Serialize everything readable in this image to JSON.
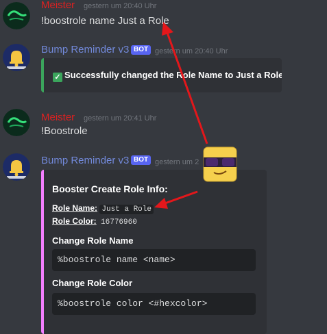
{
  "messages": [
    {
      "author": "Meister",
      "timestamp": "gestern um 20:40 Uhr",
      "content": "!boostrole name Just a Role"
    },
    {
      "author": "Bump Reminder v3",
      "badge": "BOT",
      "timestamp": "gestern um 20:40 Uhr",
      "embed_text": "Successfully changed the Role Name to Just a Role"
    },
    {
      "author": "Meister",
      "timestamp": "gestern um 20:41 Uhr",
      "content": "!Boostrole"
    },
    {
      "author": "Bump Reminder v3",
      "badge": "BOT",
      "timestamp": "gestern um 2",
      "embed": {
        "title": "Booster Create Role Info:",
        "role_name_label": "Role Name:",
        "role_name_value": "Just a Role",
        "role_color_label": "Role Color:",
        "role_color_value": "16776960",
        "change_name_heading": "Change Role Name",
        "change_name_cmd": "%boostrole name <name>",
        "change_color_heading": "Change Role Color",
        "change_color_cmd": "%boostrole color <#hexcolor>"
      }
    }
  ],
  "colors": {
    "meister": "#e02020",
    "bot_name": "#7289da",
    "success_bar": "#3ba55c",
    "booster_bar": "#f47fff",
    "arrow": "#e3171b",
    "emoji": "#f6d04d"
  },
  "icons": [
    "bell-icon",
    "checkmark-icon",
    "sunglasses-emoji"
  ]
}
